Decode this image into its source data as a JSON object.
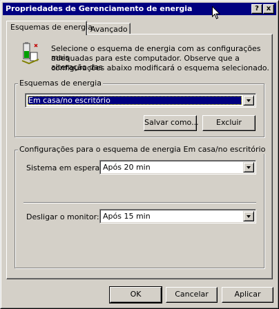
{
  "window": {
    "title": "Propriedades de Gerenciamento de energia",
    "help_button": "?",
    "close_button": "x"
  },
  "tabs": [
    {
      "label": "Esquemas de energia",
      "active": true
    },
    {
      "label": "Avançado",
      "active": false
    }
  ],
  "intro_text": {
    "line1": "Selecione o esquema de energia com as configurações mais",
    "line2": "adequadas para este computador. Observe que a alteração das",
    "line3": "configurações abaixo modificará o esquema selecionado."
  },
  "schemes_group": {
    "legend": "Esquemas de energia",
    "selected": "Em casa/no escritório",
    "save_as_button": "Salvar como...",
    "delete_button": "Excluir"
  },
  "settings_group": {
    "legend": "Configurações para o esquema de energia Em casa/no escritório",
    "standby_label": "Sistema em espera:",
    "standby_value": "Após 20 min",
    "monitor_label": "Desligar o monitor:",
    "monitor_value": "Após 15 min"
  },
  "buttons": {
    "ok": "OK",
    "cancel": "Cancelar",
    "apply": "Aplicar"
  },
  "colors": {
    "titlebar": "#000080",
    "face": "#d4d0c8",
    "selection": "#000080"
  },
  "icons": [
    "power-icon",
    "help-icon",
    "close-icon",
    "mouse-cursor-icon",
    "chevron-down-icon"
  ]
}
